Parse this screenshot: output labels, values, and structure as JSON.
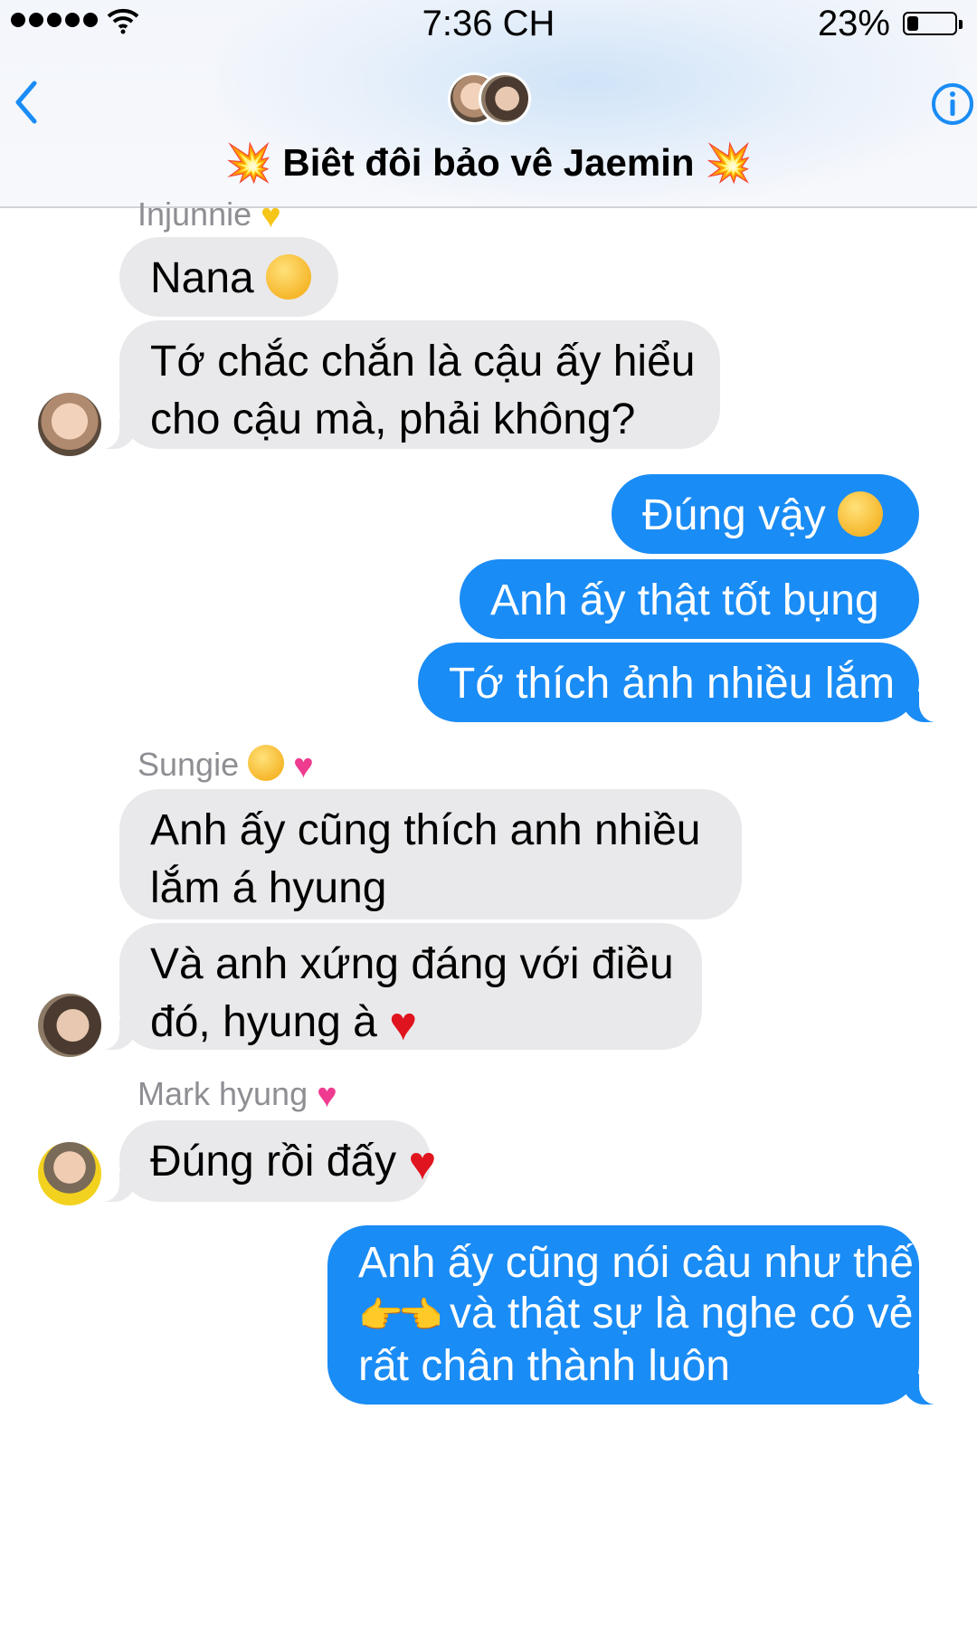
{
  "status_bar": {
    "time": "7:36 CH",
    "battery": "23%",
    "battery_level": 0.23
  },
  "header": {
    "title": "Biêt đôi bảo vê Jaemin",
    "title_left_emoji": "💥",
    "title_right_emoji": "💥",
    "back_icon": "chevron-left-icon",
    "info_icon": "info-icon"
  },
  "colors": {
    "sent_bubble": "#1a8cf5",
    "received_bubble": "#e9e9eb",
    "accent": "#1a8cf5"
  },
  "messages": {
    "g1": {
      "sender": "Injunnie",
      "sender_emoji": "💛",
      "m1": "Nana",
      "m1_emoji": "😞",
      "m2_line1": "Tớ chắc chắn là cậu ấy hiểu",
      "m2_line2": "cho cậu mà, phải không?"
    },
    "me1": {
      "m1": "Đúng vậy",
      "m1_emoji": "🥺",
      "m2": "Anh ấy thật tốt bụng",
      "m3": "Tớ thích ảnh nhiều lắm"
    },
    "g2": {
      "sender": "Sungie",
      "sender_emoji": "🥺💕",
      "m1_line1": "Anh ấy cũng thích anh nhiều",
      "m1_line2": "lắm á hyung",
      "m2_line1": "Và anh xứng đáng với điều",
      "m2_line2": "đó, hyung à",
      "m2_emoji": "❤️"
    },
    "g3": {
      "sender": "Mark hyung",
      "sender_emoji": "💞",
      "m1": "Đúng rồi đấy",
      "m1_emoji": "❤️"
    },
    "me2": {
      "line1": "Anh ấy cũng nói câu như thế",
      "line2_emoji": "👉👈",
      "line2": "và thật sự là nghe có vẻ",
      "line3": "rất chân thành luôn"
    }
  }
}
